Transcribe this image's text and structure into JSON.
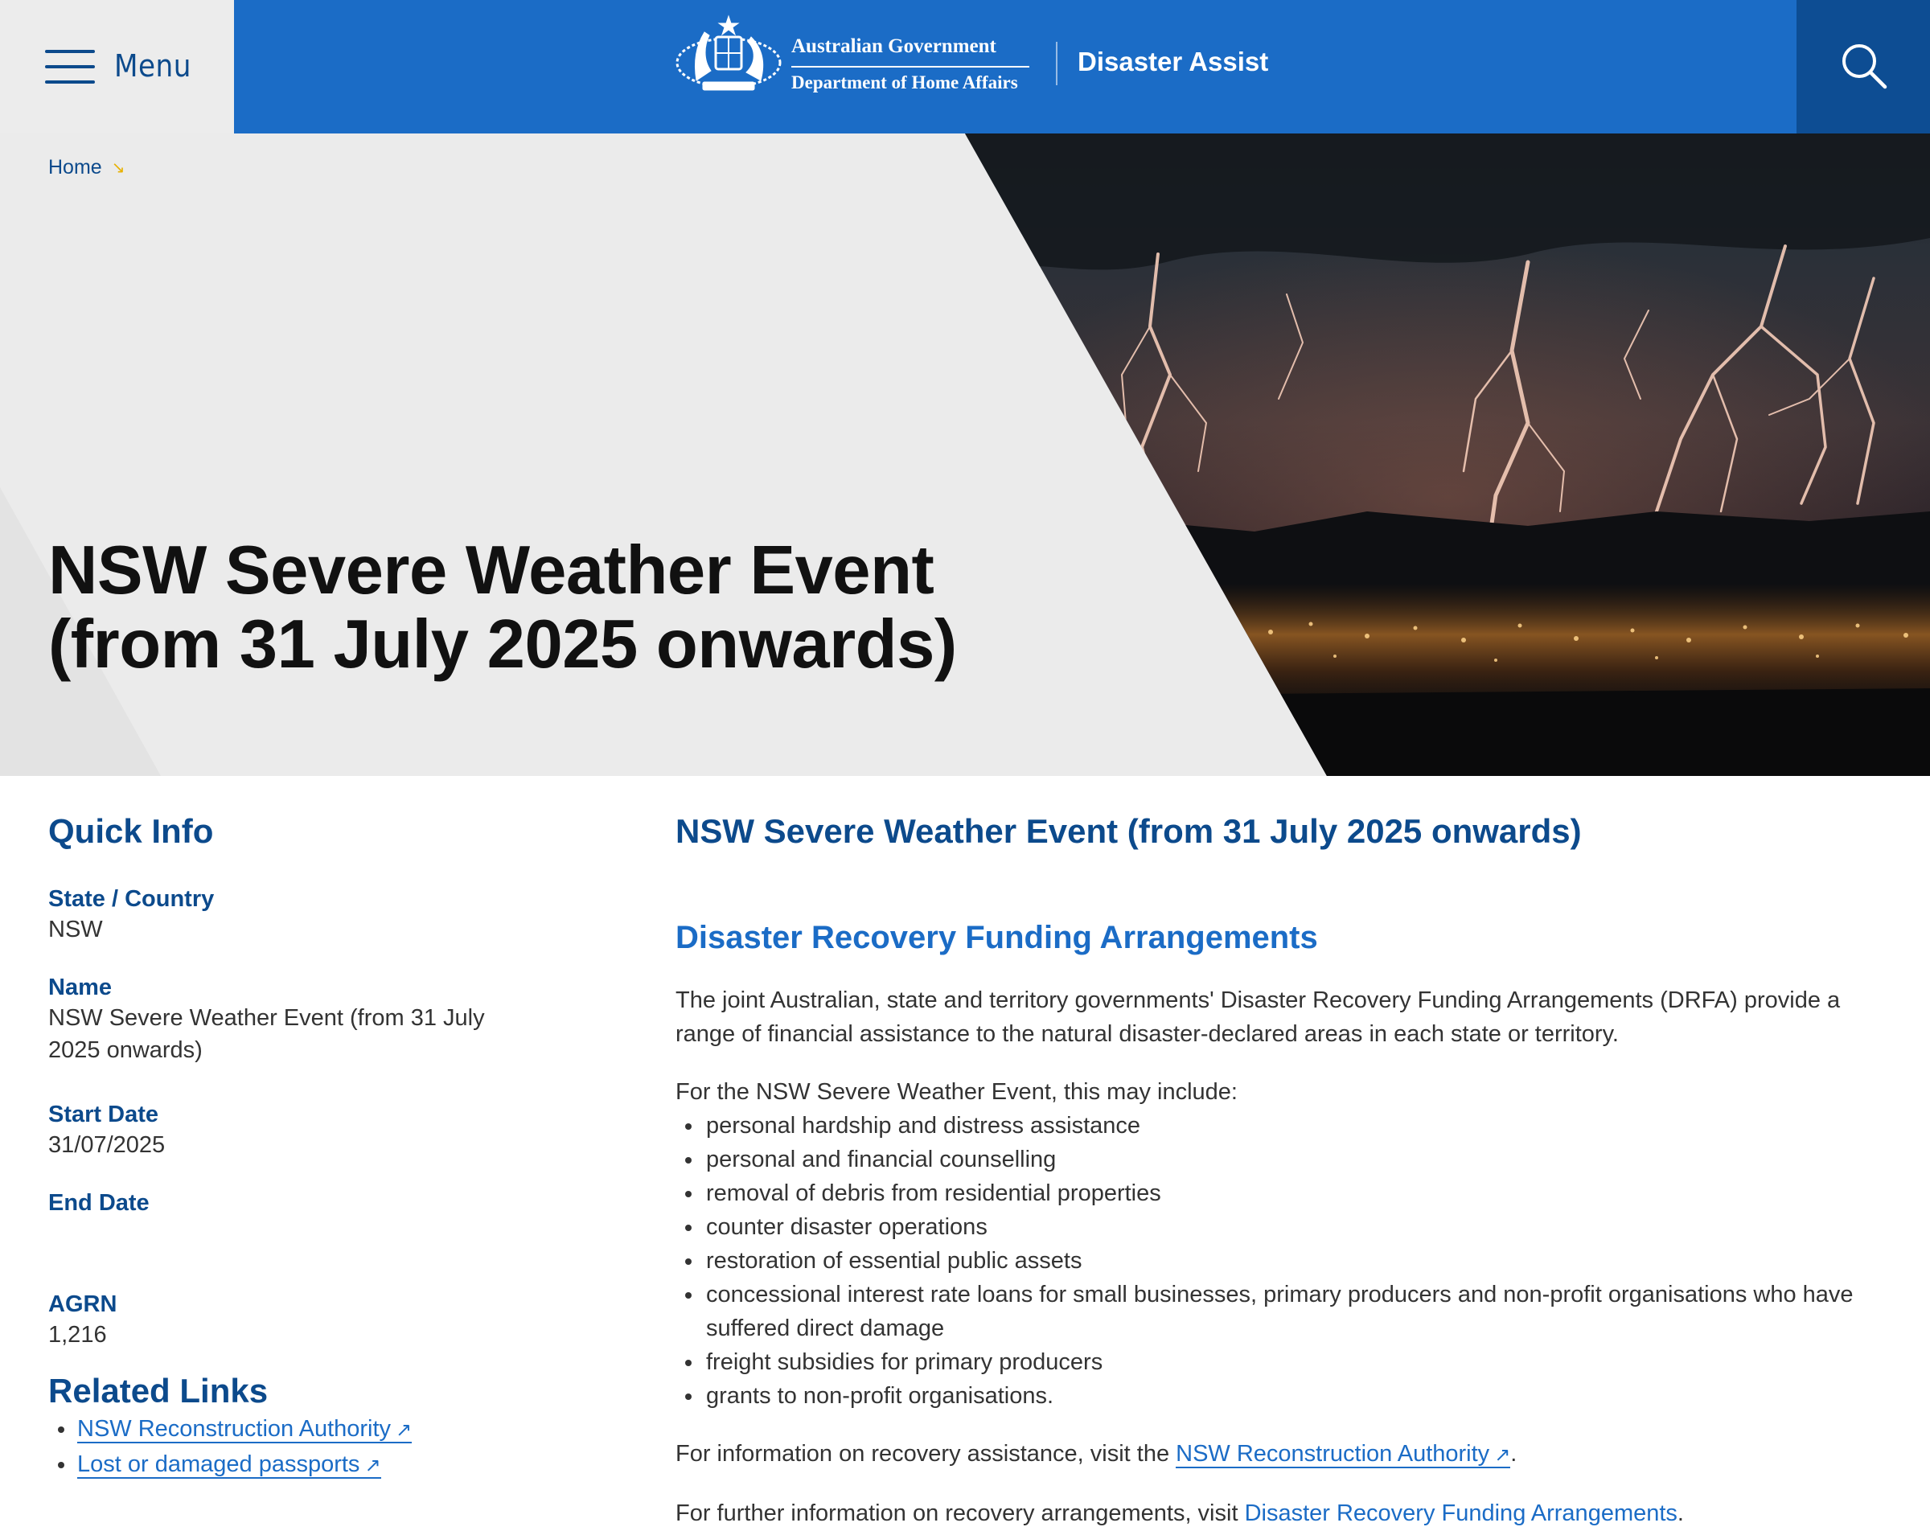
{
  "header": {
    "menu_label": "Menu",
    "gov_name": "Australian Government",
    "dept_name": "Department of Home Affairs",
    "site_title": "Disaster Assist",
    "search_icon": "search-icon",
    "colors": {
      "brand_blue": "#1b6cc6",
      "dark_blue": "#0d4d93",
      "text_blue": "#0c4a8c"
    }
  },
  "breadcrumb": {
    "home": "Home",
    "separator": "↘"
  },
  "hero": {
    "title_line1": "NSW Severe Weather Event",
    "title_line2": "(from 31 July 2025 onwards)"
  },
  "quick_info": {
    "title": "Quick Info",
    "items": [
      {
        "label": "State / Country",
        "value": "NSW"
      },
      {
        "label": "Name",
        "value": "NSW Severe Weather Event (from 31 July 2025 onwards)"
      },
      {
        "label": "Start Date",
        "value": "31/07/2025"
      },
      {
        "label": "End Date",
        "value": ""
      },
      {
        "label": "AGRN",
        "value": "1,216"
      }
    ]
  },
  "related_links": {
    "title": "Related Links",
    "items": [
      {
        "label": "NSW Reconstruction Authority",
        "arrow": "↗"
      },
      {
        "label": "Lost or damaged passports",
        "arrow": "↗"
      }
    ]
  },
  "main": {
    "title": "NSW Severe Weather Event (from 31 July 2025 onwards)",
    "section_title": "Disaster Recovery Funding Arrangements",
    "para1": "The joint Australian, state and territory governments' Disaster Recovery Funding Arrangements (DRFA) provide a range of financial assistance to the natural disaster-declared areas in each state or territory.",
    "intro": "For the NSW Severe Weather Event, this may include:",
    "bullets": [
      "personal hardship and distress assistance",
      "personal and financial counselling",
      "removal of debris from residential properties",
      "counter disaster operations",
      "restoration of essential public assets",
      "concessional interest rate loans for small businesses, primary producers and non-profit organisations who have suffered direct damage",
      "freight subsidies for primary producers",
      "grants to non-profit organisations."
    ],
    "recovery_prefix": "For information on recovery assistance, visit the ",
    "recovery_link": "NSW Reconstruction Authority",
    "recovery_arrow": "↗",
    "recovery_suffix": ".",
    "further_prefix": "For further information on recovery arrangements, visit ",
    "further_link": "Disaster Recovery Funding Arrangements",
    "further_suffix": "."
  }
}
